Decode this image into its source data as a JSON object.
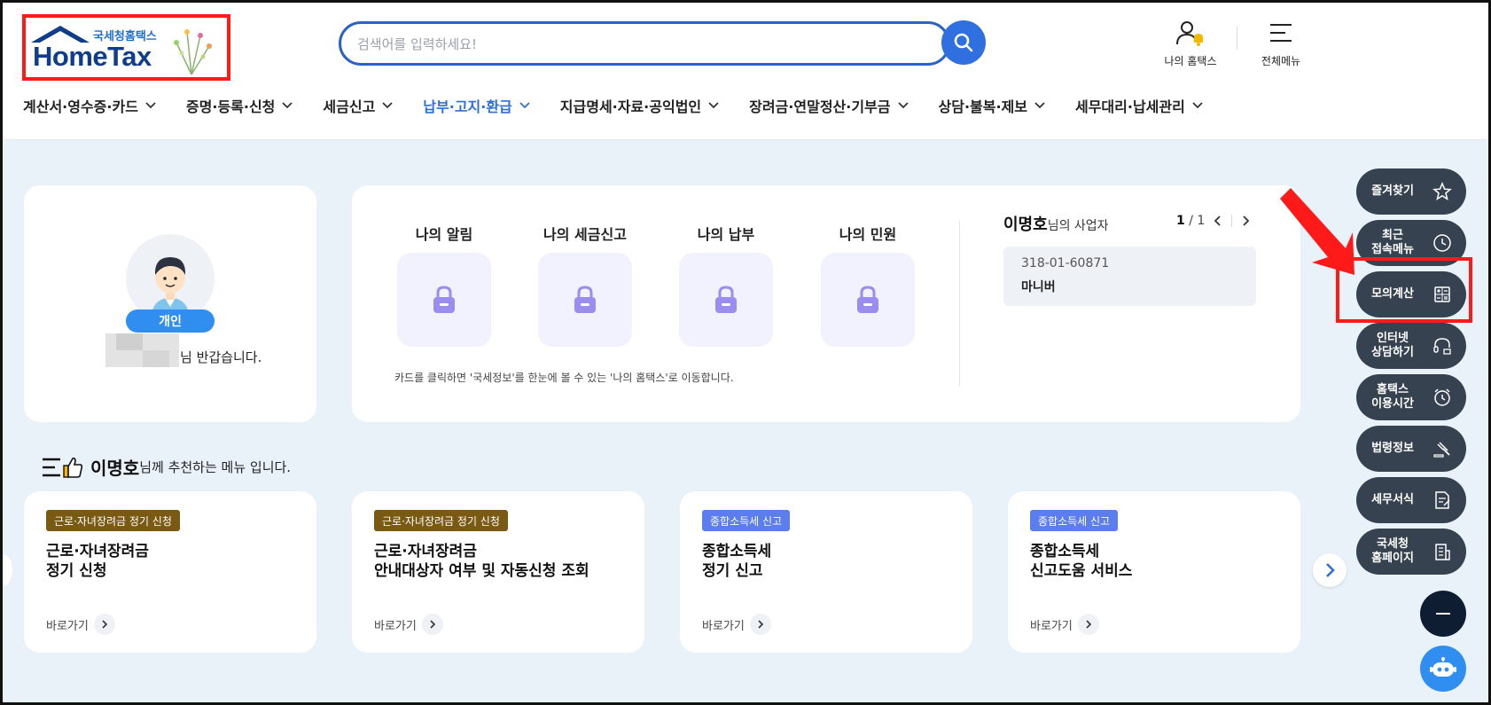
{
  "logo": {
    "kr": "국세청홈택스",
    "en": "HomeTax"
  },
  "search": {
    "placeholder": "검색어를 입력하세요!"
  },
  "header": {
    "my_hometax": "나의 홈택스",
    "all_menu": "전체메뉴"
  },
  "gnb": [
    {
      "label": "계산서·영수증·카드",
      "active": false
    },
    {
      "label": "증명·등록·신청",
      "active": false
    },
    {
      "label": "세금신고",
      "active": false
    },
    {
      "label": "납부·고지·환급",
      "active": true
    },
    {
      "label": "지급명세·자료·공익법인",
      "active": false
    },
    {
      "label": "장려금·연말정산·기부금",
      "active": false
    },
    {
      "label": "상담·불복·제보",
      "active": false
    },
    {
      "label": "세무대리·납세관리",
      "active": false
    }
  ],
  "profile": {
    "badge": "개인",
    "greeting": "님 반갑습니다."
  },
  "tiles": [
    {
      "title": "나의 알림"
    },
    {
      "title": "나의 세금신고"
    },
    {
      "title": "나의 납부"
    },
    {
      "title": "나의 민원"
    }
  ],
  "info_note": "카드를 클릭하면 '국세정보'를 한눈에 볼 수 있는 '나의 홈택스'로 이동합니다.",
  "business": {
    "name": "이명호",
    "suffix": "님의 사업자",
    "page_current": "1",
    "page_total": "/ 1",
    "reg_no": "318-01-60871",
    "biz_name": "마니버"
  },
  "recommend": {
    "name": "이명호",
    "rest": "님께 추천하는 메뉴 입니다."
  },
  "rec_cards": [
    {
      "tag": "근로·자녀장려금 정기 신청",
      "tag_color": "#7a5a12",
      "line1": "근로·자녀장려금",
      "line2": "정기 신청",
      "go": "바로가기"
    },
    {
      "tag": "근로·자녀장려금 정기 신청",
      "tag_color": "#7a5a12",
      "line1": "근로·자녀장려금",
      "line2": "안내대상자 여부 및 자동신청 조회",
      "go": "바로가기"
    },
    {
      "tag": "종합소득세 신고",
      "tag_color": "#5b7df0",
      "line1": "종합소득세",
      "line2": "정기 신고",
      "go": "바로가기"
    },
    {
      "tag": "종합소득세 신고",
      "tag_color": "#5b7df0",
      "line1": "종합소득세",
      "line2": "신고도움 서비스",
      "go": "바로가기"
    }
  ],
  "quick_menu": [
    {
      "label": "즐겨찾기",
      "icon": "star-icon"
    },
    {
      "label": "최근\n접속메뉴",
      "icon": "clock-icon"
    },
    {
      "label": "모의계산",
      "icon": "calculator-icon"
    },
    {
      "label": "인터넷\n상담하기",
      "icon": "headset-icon"
    },
    {
      "label": "홈택스\n이용시간",
      "icon": "alarm-icon"
    },
    {
      "label": "법령정보",
      "icon": "gavel-icon"
    },
    {
      "label": "세무서식",
      "icon": "form-icon"
    },
    {
      "label": "국세청\n홈페이지",
      "icon": "building-icon"
    }
  ],
  "colors": {
    "primary": "#2f6fe0",
    "active_menu": "#2b6fd9",
    "quick_bg": "#36424f",
    "page_bg": "#e9f1f9",
    "annotation": "#ff1a1a"
  }
}
